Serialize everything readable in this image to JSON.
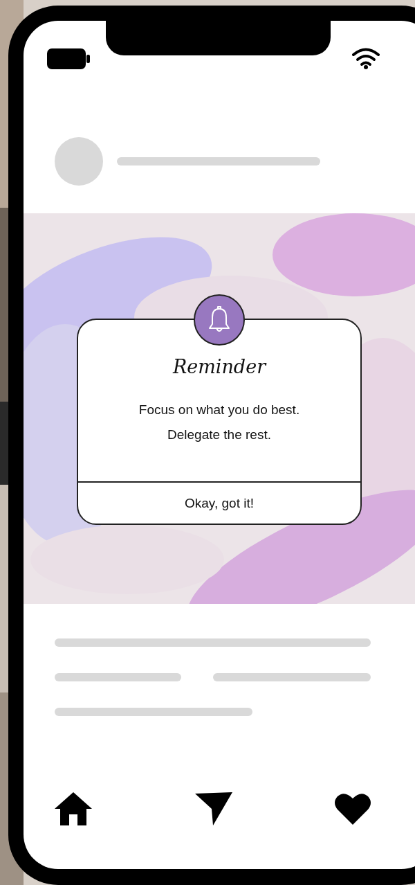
{
  "dialog": {
    "title": "Reminder",
    "message_lines": [
      "Focus on what you do best.",
      "Delegate the rest."
    ],
    "button": "Okay, got it!"
  }
}
